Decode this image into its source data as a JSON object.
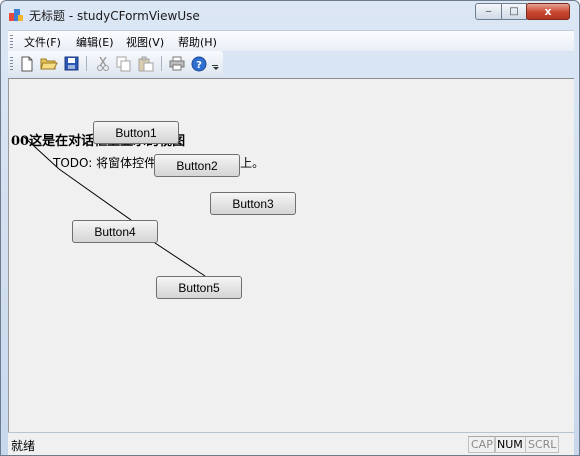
{
  "window": {
    "title": "无标题 - studyCFormViewUse"
  },
  "title_controls": {
    "minimize": "‒",
    "maximize": "□",
    "close": "x"
  },
  "menu": [
    "文件(F)",
    "编辑(E)",
    "视图(V)",
    "帮助(H)"
  ],
  "toolbar": {
    "icons": [
      "new-file-icon",
      "open-folder-icon",
      "save-icon",
      "cut-icon",
      "copy-icon",
      "paste-icon",
      "print-icon",
      "help-icon"
    ]
  },
  "view": {
    "heading": "00这是在对话框上显示的视图",
    "todo": "TODO: 将窗体控件放置在此对话框上。",
    "buttons": [
      "Button1",
      "Button2",
      "Button3",
      "Button4",
      "Button5"
    ]
  },
  "status": {
    "ready": "就绪",
    "cap": "CAP",
    "num": "NUM",
    "scrl": "SCRL"
  }
}
